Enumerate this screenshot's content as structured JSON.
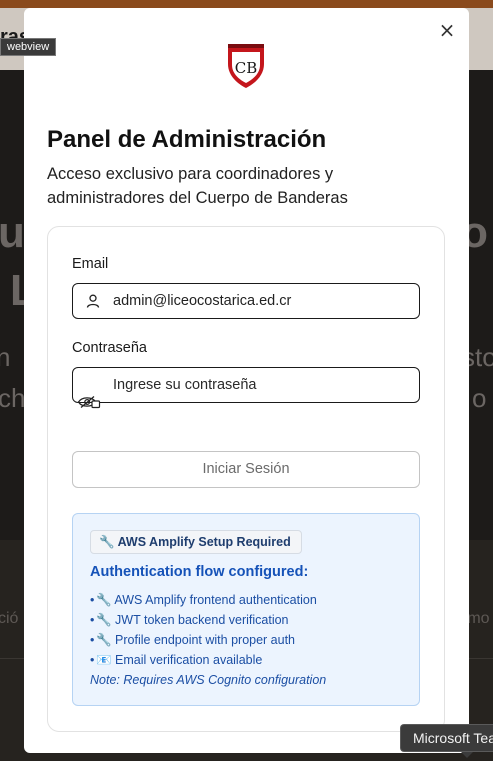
{
  "background": {
    "header_fragment": "ras",
    "hero_fragments": [
      "u",
      "ro",
      "L",
      "n",
      "sto",
      "ch",
      "o"
    ],
    "lower_fragments": [
      "ció",
      "rmo"
    ]
  },
  "webview_label": "webview",
  "modal": {
    "close_symbol": "×",
    "title": "Panel de Administración",
    "subtitle": "Acceso exclusivo para coordinadores y administradores del Cuerpo de Banderas",
    "logo_letters": "CB",
    "form": {
      "email_label": "Email",
      "email_value": "admin@liceocostarica.ed.cr",
      "password_label": "Contraseña",
      "password_placeholder": "Ingrese su contraseña",
      "submit_label": "Iniciar Sesión"
    },
    "info": {
      "badge": "🔧 AWS Amplify Setup Required",
      "heading": "Authentication flow configured:",
      "items": [
        "🔧 AWS Amplify frontend authentication",
        "🔧 JWT token backend verification",
        "🔧 Profile endpoint with proper auth",
        "📧 Email verification available"
      ],
      "note": "Note: Requires AWS Cognito configuration"
    }
  },
  "tooltip": "Microsoft Teams",
  "colors": {
    "accent_blue": "#1552b8",
    "info_background": "#ecf4fe",
    "logo_red": "#c4161c"
  },
  "icons": [
    "close-icon",
    "shield-logo",
    "user-icon",
    "eye-slash-icon"
  ]
}
